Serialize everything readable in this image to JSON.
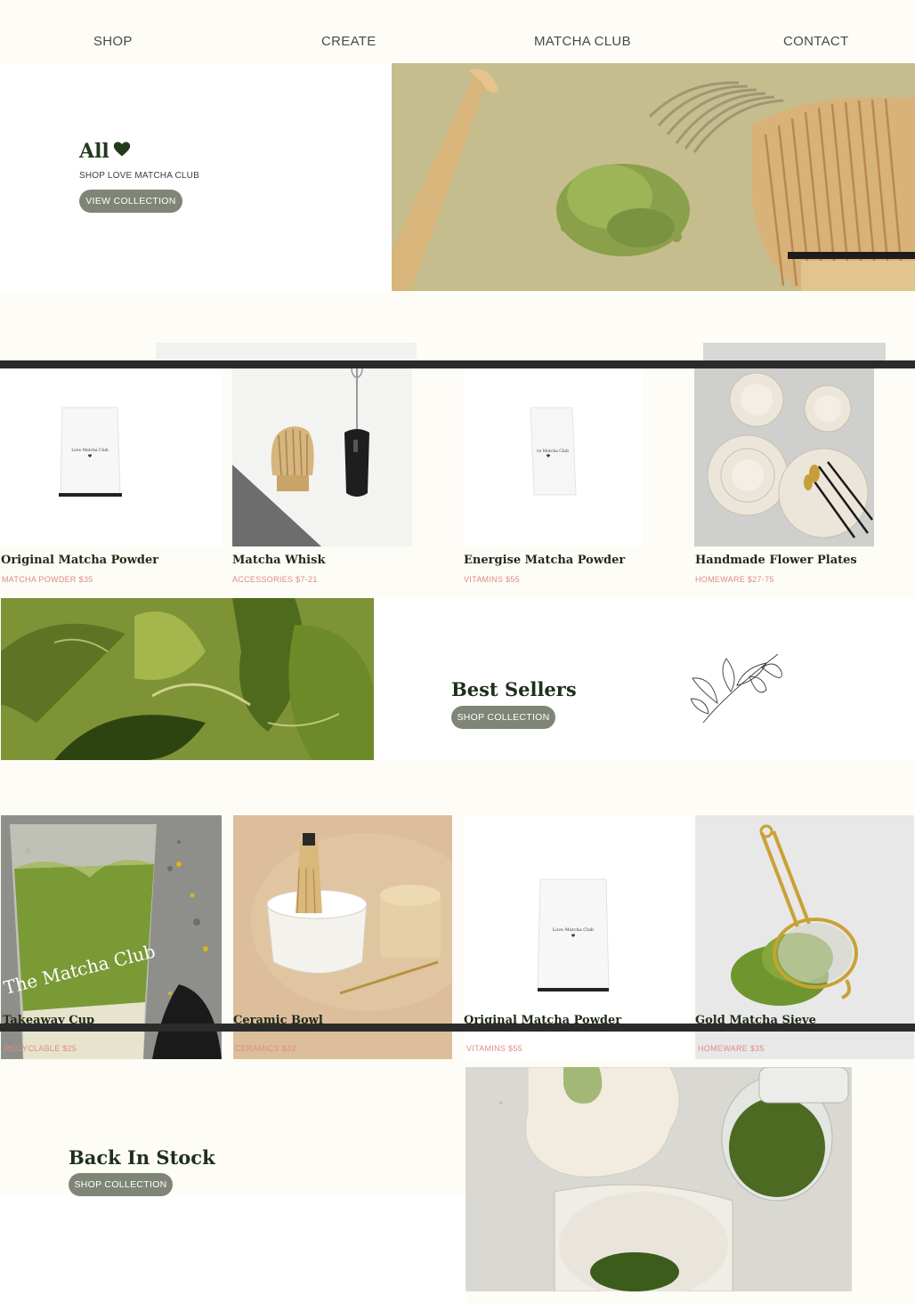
{
  "nav": {
    "items": [
      {
        "label": "SHOP"
      },
      {
        "label": "CREATE"
      },
      {
        "label": "MATCHA CLUB"
      },
      {
        "label": "CONTACT"
      }
    ]
  },
  "hero": {
    "title": "All",
    "subtitle": "SHOP LOVE MATCHA CLUB",
    "button_label": "VIEW COLLECTION"
  },
  "products_row1": [
    {
      "name": "Original Matcha Powder",
      "meta": "MATCHA POWDER $35",
      "image": "white-pouch",
      "pouch_label": "Love Matcha Club"
    },
    {
      "name": "Matcha Whisk",
      "meta": "ACCESSORIES $7-21",
      "image": "whisk-and-frother"
    },
    {
      "name": "Energise Matcha Powder",
      "meta": "VITAMINS $55",
      "image": "white-pouch-small",
      "pouch_label": "ve Matcha Club"
    },
    {
      "name": "Handmade Flower Plates",
      "meta": "HOMEWARE $27-75",
      "image": "flower-plates"
    }
  ],
  "best_sellers": {
    "title": "Best Sellers",
    "button_label": "SHOP COLLECTION"
  },
  "products_row2": [
    {
      "name": "Takeaway Cup",
      "meta": "RECYCLABLE $25",
      "image": "iced-matcha-cup",
      "cup_text": "The Matcha Club"
    },
    {
      "name": "Ceramic Bowl",
      "meta": "CERAMICS $32",
      "image": "ceramic-bowl-set"
    },
    {
      "name": "Original Matcha Powder",
      "meta": "VITAMINS  $55",
      "image": "white-pouch",
      "pouch_label": "Love Matcha Club"
    },
    {
      "name": "Gold Matcha Sieve",
      "meta": "HOMEWARE  $35",
      "image": "gold-sieve"
    }
  ],
  "back_in_stock": {
    "title": "Back In Stock",
    "button_label": "SHOP COLLECTION"
  },
  "colors": {
    "background": "#fdfcf6",
    "button": "#7f8677",
    "heading": "#1f2f1b",
    "price_accent": "#e28a86",
    "matcha_green": "#7f9a3e"
  }
}
